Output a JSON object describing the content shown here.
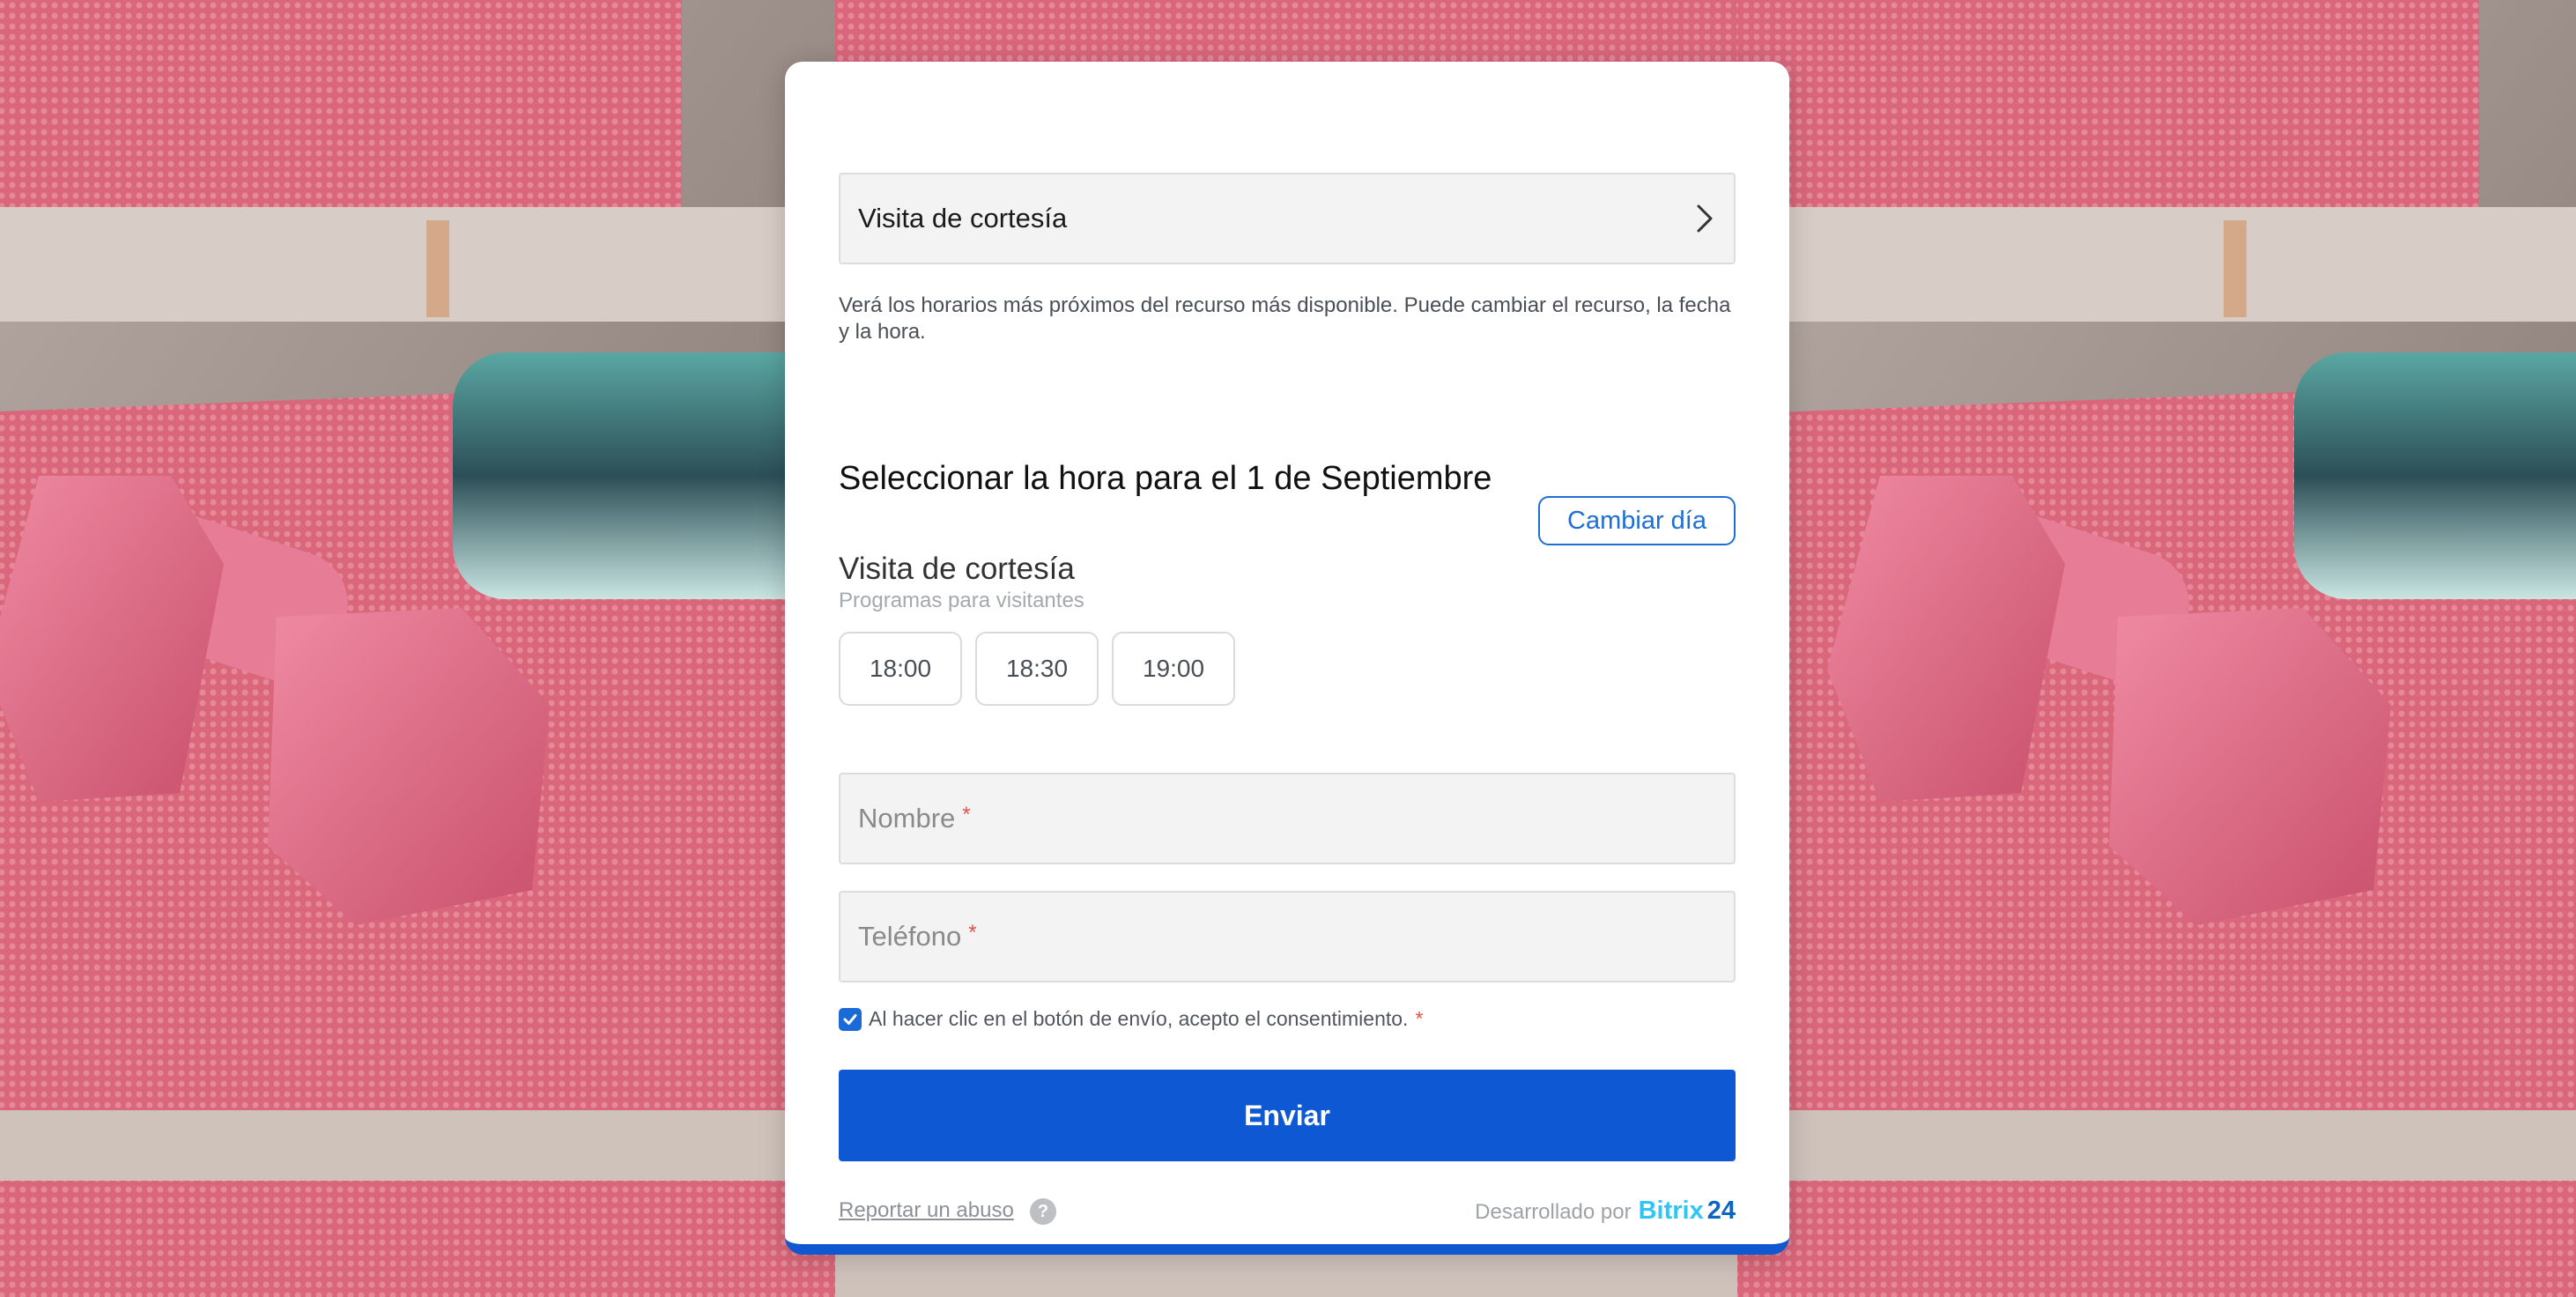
{
  "service_select": {
    "label": "Visita de cortesía",
    "icon": "chevron-right-icon"
  },
  "description": "Verá los horarios más próximos del recurso más disponible. Puede cambiar el recurso, la fecha y la hora.",
  "time_section": {
    "title": "Seleccionar la hora para el 1 de Septiembre",
    "service_name": "Visita de cortesía",
    "service_subtitle": "Programas para visitantes",
    "change_day_label": "Cambiar día",
    "slots": [
      "18:00",
      "18:30",
      "19:00"
    ]
  },
  "form": {
    "name_placeholder": "Nombre",
    "phone_placeholder": "Teléfono",
    "required_mark": "*",
    "consent_text": "Al hacer clic en el botón de envío, acepto el consentimiento.",
    "consent_checked": true,
    "submit_label": "Enviar"
  },
  "footer": {
    "report_label": "Reportar un abuso",
    "help_icon": "question-icon",
    "help_glyph": "?",
    "powered_label": "Desarrollado por",
    "brand_part1": "Bitrix",
    "brand_part2": "24"
  },
  "colors": {
    "primary": "#0f58d3",
    "accent_link": "#1f6ed4",
    "required": "#e0534d",
    "brand_cyan": "#2fc6f6",
    "brand_blue": "#0b66c3"
  },
  "background": {
    "icon": "dumbbell-on-yoga-mat-photo"
  }
}
